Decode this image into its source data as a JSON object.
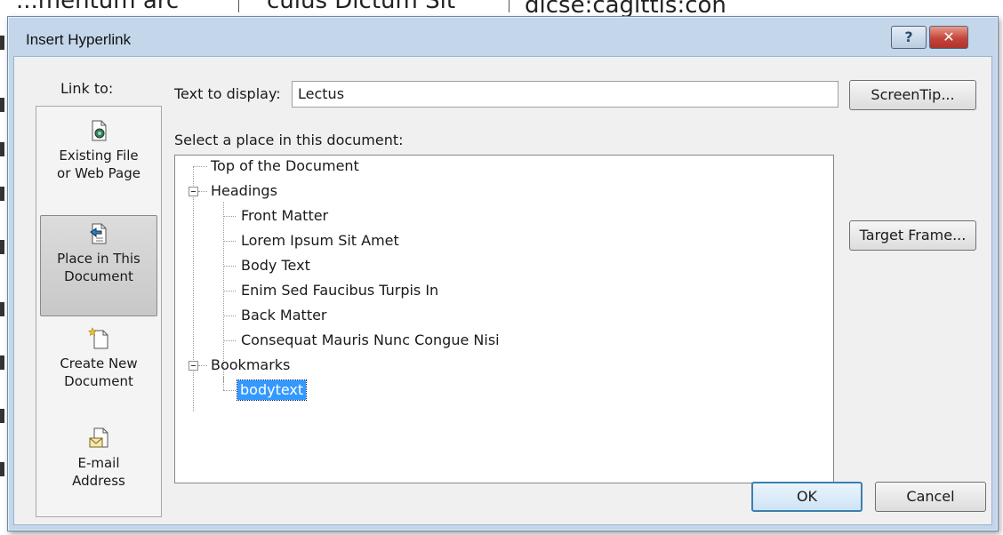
{
  "background": {
    "texts": [
      "...mentum arc",
      "culus Dictum Sit",
      "dicse:cagittis:con"
    ]
  },
  "dialog": {
    "title": "Insert Hyperlink",
    "help_glyph": "?",
    "close_glyph": "✕"
  },
  "link_to": {
    "label": "Link to:",
    "items": [
      {
        "line1": "Existing File",
        "line2": "or Web Page",
        "icon": "existing-file-icon",
        "selected": false
      },
      {
        "line1": "Place in This",
        "line2": "Document",
        "icon": "place-in-document-icon",
        "selected": true
      },
      {
        "line1": "Create New",
        "line2": "Document",
        "icon": "create-new-document-icon",
        "selected": false
      },
      {
        "line1": "E-mail",
        "line2": "Address",
        "icon": "email-address-icon",
        "selected": false
      }
    ]
  },
  "text_to_display": {
    "label": "Text to display:",
    "value": "Lectus"
  },
  "place_label": "Select a place in this document:",
  "tree": {
    "top": "Top of the Document",
    "headings_label": "Headings",
    "headings": [
      "Front Matter",
      "Lorem Ipsum Sit Amet",
      "Body Text",
      "Enim Sed Faucibus Turpis In",
      "Back Matter",
      "Consequat Mauris Nunc Congue Nisi"
    ],
    "bookmarks_label": "Bookmarks",
    "bookmarks": [
      "bodytext"
    ],
    "selected": "bodytext"
  },
  "buttons": {
    "screentip": "ScreenTip...",
    "target_frame": "Target Frame...",
    "ok": "OK",
    "cancel": "Cancel"
  },
  "colors": {
    "dialog_frame": "#c3d6ea",
    "selection": "#3399ff",
    "close_button": "#c4443a"
  }
}
